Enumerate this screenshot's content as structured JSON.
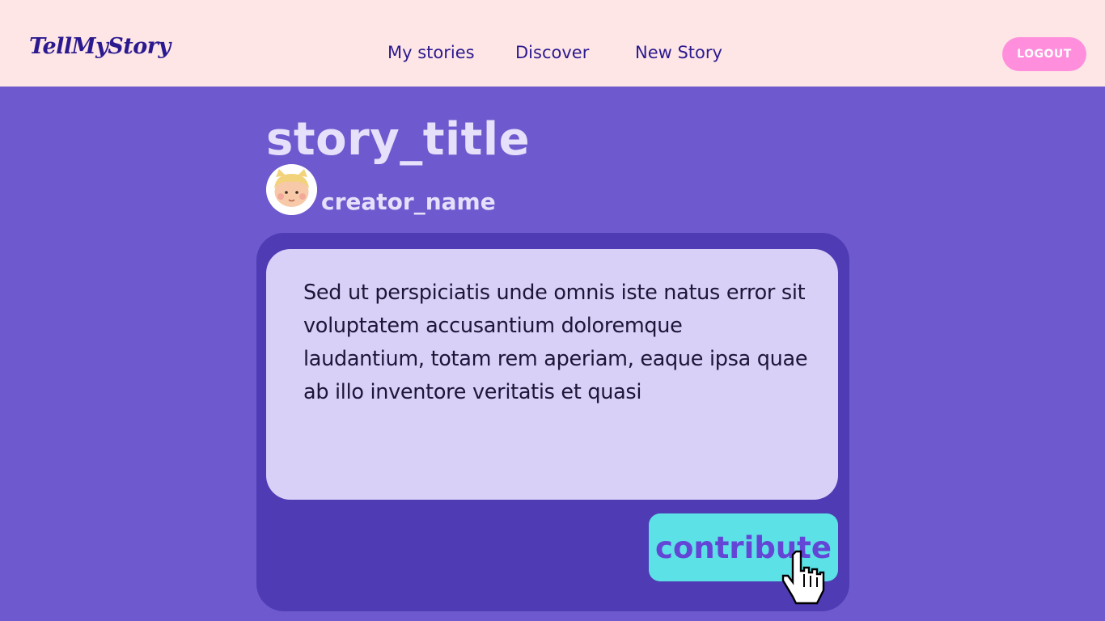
{
  "header": {
    "logo": "TellMyStory",
    "nav": {
      "my_stories": "My stories",
      "discover": "Discover",
      "new_story": "New Story"
    },
    "logout_label": "LOGOUT"
  },
  "story": {
    "title": "story_title",
    "creator_name": "creator_name",
    "text": "Sed ut perspiciatis unde omnis iste natus error sit voluptatem accusantium doloremque laudantium, totam rem aperiam, eaque ipsa quae ab illo inventore veritatis et quasi",
    "contribute_label": "contribute"
  },
  "icons": {
    "avatar": "avatar-icon",
    "pointer": "hand-pointer-icon"
  },
  "colors": {
    "header_bg": "#ffe6e6",
    "page_bg": "#6e5ace",
    "card_bg": "#4f3bb3",
    "text_panel_bg": "#d9d0f8",
    "logout_bg": "#ff8fdc",
    "contribute_bg": "#5ce1e6",
    "contribute_text": "#6446d6",
    "nav_text": "#2b1a8f"
  }
}
